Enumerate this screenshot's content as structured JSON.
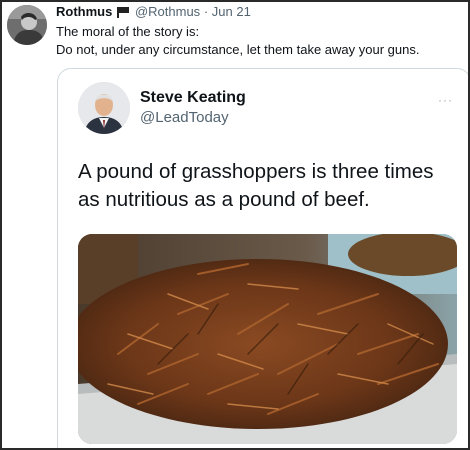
{
  "outer_tweet": {
    "name": "Rothmus",
    "flag_icon": "black-flag-icon",
    "handle": "@Rothmus",
    "separator": "·",
    "date": "Jun 21",
    "text_line1": "The moral of the story is:",
    "text_line2": "Do not, under any circumstance, let them take away your guns."
  },
  "quoted_tweet": {
    "name": "Steve Keating",
    "handle": "@LeadToday",
    "more_icon": "more-options-icon",
    "more_glyph": "···",
    "text": "A pound of grasshoppers is three times as nutritious as a pound of beef.",
    "image": "tray-of-fried-grasshoppers"
  },
  "colors": {
    "text_primary": "#0f1419",
    "text_secondary": "#536471",
    "card_border": "#cfd9de",
    "frame_border": "#2a2a2a"
  }
}
